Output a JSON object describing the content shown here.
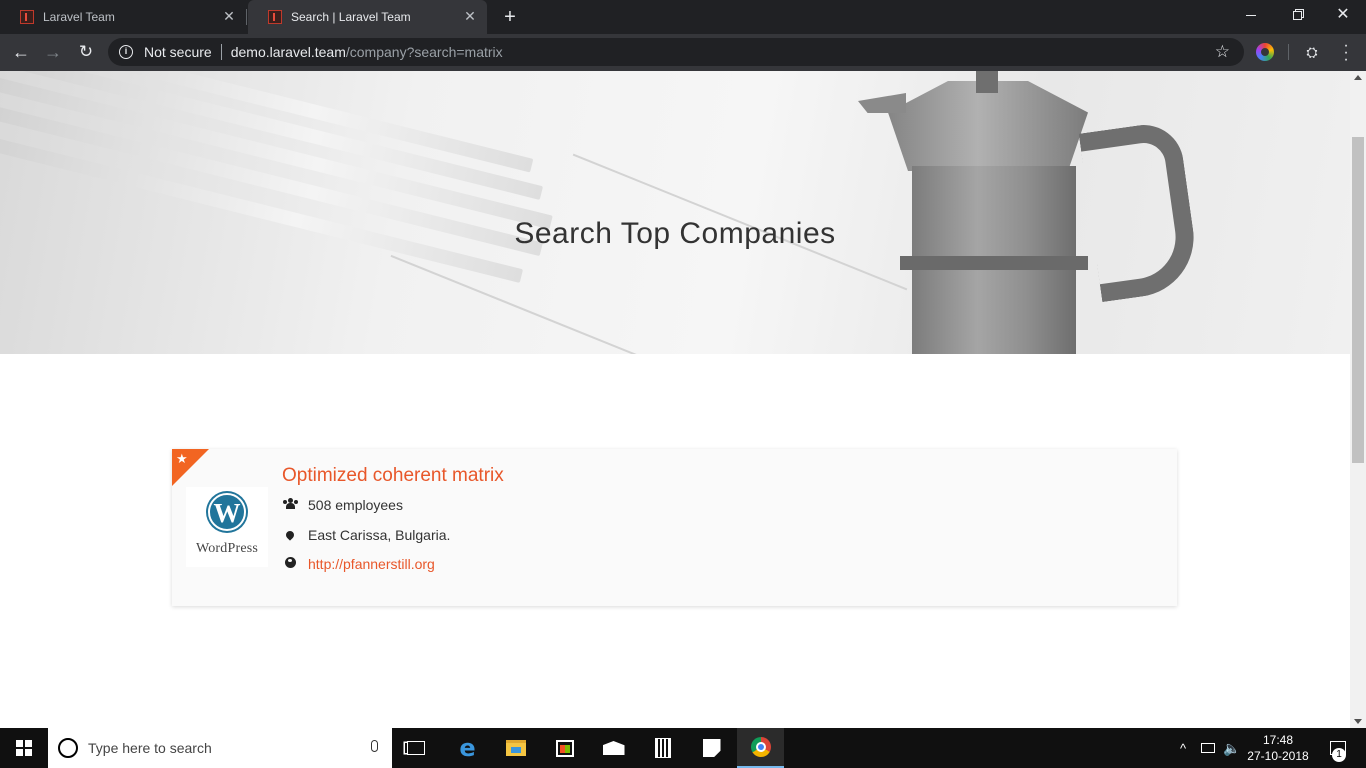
{
  "browser": {
    "tabs": [
      {
        "title": "Laravel Team",
        "active": false
      },
      {
        "title": "Search | Laravel Team",
        "active": true
      }
    ],
    "new_tab_symbol": "+",
    "close_symbol": "✕",
    "address": {
      "security_label": "Not secure",
      "host": "demo.laravel.team",
      "path": "/company?search=matrix"
    },
    "icons": [
      "back-icon",
      "forward-icon",
      "reload-icon",
      "info-icon",
      "star-icon",
      "color-extension-icon",
      "incognito-extension-icon",
      "menu-icon"
    ]
  },
  "page": {
    "hero_title": "Search Top Companies",
    "results": [
      {
        "name": "Optimized coherent matrix",
        "featured": true,
        "logo_text": "WordPress",
        "logo_mark": "W",
        "employees": "508 employees",
        "location": "East Carissa, Bulgaria.",
        "website": "http://pfannerstill.org"
      }
    ],
    "accent_color": "#e8572a"
  },
  "taskbar": {
    "search_placeholder": "Type here to search",
    "time": "17:48",
    "date": "27-10-2018",
    "notification_count": "1",
    "apps": [
      "task-view",
      "edge",
      "file-explorer",
      "store",
      "mail",
      "calculator",
      "sticky-notes",
      "chrome"
    ]
  }
}
